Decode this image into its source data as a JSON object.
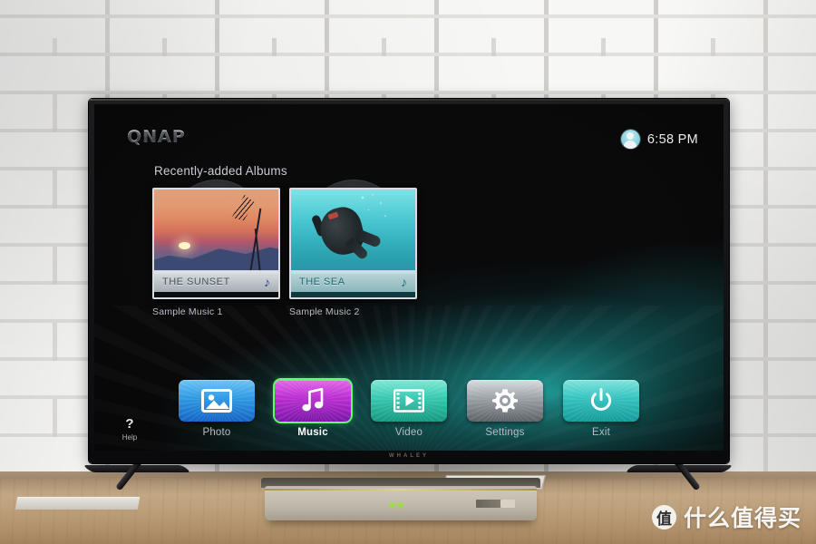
{
  "photo": {
    "tv_brand": "WHALEY",
    "watermark": {
      "logo_char": "值",
      "text": "什么值得买"
    }
  },
  "screen": {
    "header": {
      "logo": "QNAP",
      "avatar_icon": "user-avatar-icon",
      "clock": "6:58 PM"
    },
    "section_title": "Recently-added Albums",
    "albums": [
      {
        "cover_title": "THE SUNSET",
        "label": "Sample Music 1",
        "art": "sunset-photo",
        "note_icon": "music-note-icon"
      },
      {
        "cover_title": "THE SEA",
        "label": "Sample Music 2",
        "art": "scuba-diver-photo",
        "note_icon": "music-note-icon"
      }
    ],
    "nav": [
      {
        "label": "Photo",
        "icon": "photo-icon",
        "selected": false,
        "color": "#2f9ae4"
      },
      {
        "label": "Music",
        "icon": "music-icon",
        "selected": true,
        "color": "#bf2fd4"
      },
      {
        "label": "Video",
        "icon": "video-icon",
        "selected": false,
        "color": "#38c9b2"
      },
      {
        "label": "Settings",
        "icon": "gear-icon",
        "selected": false,
        "color": "#9aa0a6"
      },
      {
        "label": "Exit",
        "icon": "power-icon",
        "selected": false,
        "color": "#36c4c0"
      }
    ],
    "selection_color": "#5dfd6b",
    "help": {
      "icon": "question-mark-icon",
      "glyph": "?",
      "label": "Help"
    }
  }
}
